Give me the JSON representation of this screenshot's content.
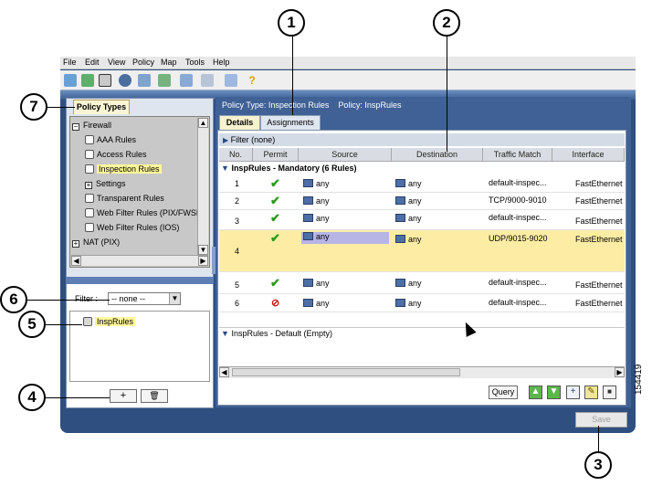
{
  "menubar": {
    "items": [
      "File",
      "Edit",
      "View",
      "Policy",
      "Map",
      "Tools",
      "Help"
    ]
  },
  "toolbar": {
    "icons": [
      "device-view-icon",
      "policy-view-icon",
      "map-view-icon",
      "object-manager-icon",
      "topology-icon",
      "deploy-icon",
      "activities-icon",
      "submit-icon",
      "workflow-icon",
      "help-icon"
    ]
  },
  "left": {
    "tab_label": "Policy Types",
    "tree": [
      {
        "label": "Firewall",
        "kind": "folder-open"
      },
      {
        "label": "AAA Rules",
        "kind": "leaf"
      },
      {
        "label": "Access Rules",
        "kind": "leaf"
      },
      {
        "label": "Inspection Rules",
        "kind": "leaf-selected"
      },
      {
        "label": "Settings",
        "kind": "folder-closed"
      },
      {
        "label": "Transparent Rules",
        "kind": "leaf"
      },
      {
        "label": "Web Filter Rules (PIX/FWSM",
        "kind": "leaf"
      },
      {
        "label": "Web Filter Rules (IOS)",
        "kind": "leaf"
      },
      {
        "label": "NAT (PIX)",
        "kind": "folder-closed"
      }
    ],
    "filter_label": "Filter :",
    "filter_value": "-- none --",
    "shared_policy": "InspRules",
    "add_label": "+",
    "delete_label": "🗑"
  },
  "right": {
    "policy_type_label": "Policy Type: Inspection Rules",
    "policy_label": "Policy: InspRules",
    "tabs": [
      "Details",
      "Assignments"
    ],
    "filter_text": "Filter (none)",
    "columns": [
      "No.",
      "Permit",
      "Source",
      "Destination",
      "Traffic Match",
      "Interface"
    ],
    "mandatory_section": "InspRules - Mandatory (6 Rules)",
    "default_section": "InspRules - Default (Empty)",
    "rows": [
      {
        "no": "1",
        "permit": "✔",
        "source": "any",
        "destination": "any",
        "traffic": "default-inspec...",
        "iface": "FastEthernet("
      },
      {
        "no": "2",
        "permit": "✔",
        "source": "any",
        "destination": "any",
        "traffic": "TCP/9000-9010",
        "iface": "FastEthernet("
      },
      {
        "no": "3",
        "permit": "✔",
        "source": "any",
        "destination": "any",
        "traffic": "default-inspec...",
        "iface": "FastEthernet("
      },
      {
        "no": "4",
        "permit": "✔",
        "source": "any",
        "destination": "any",
        "traffic": "UDP/9015-9020",
        "iface": "FastEthernet("
      },
      {
        "no": "5",
        "permit": "✔",
        "source": "any",
        "destination": "any",
        "traffic": "default-inspec...",
        "iface": "FastEthernet("
      },
      {
        "no": "6",
        "permit": "⊘",
        "source": "any",
        "destination": "any",
        "traffic": "default-inspec...",
        "iface": "FastEthernet("
      }
    ],
    "query_label": "Query",
    "save_label": "Save"
  },
  "callouts": [
    "1",
    "2",
    "3",
    "4",
    "5",
    "6",
    "7"
  ],
  "figure_number": "154419",
  "colors": {
    "frame": "#2f4f80",
    "selection": "#fdeda4",
    "highlight": "#fff89a",
    "permit": "#2a9a1c",
    "deny": "#d01010"
  }
}
